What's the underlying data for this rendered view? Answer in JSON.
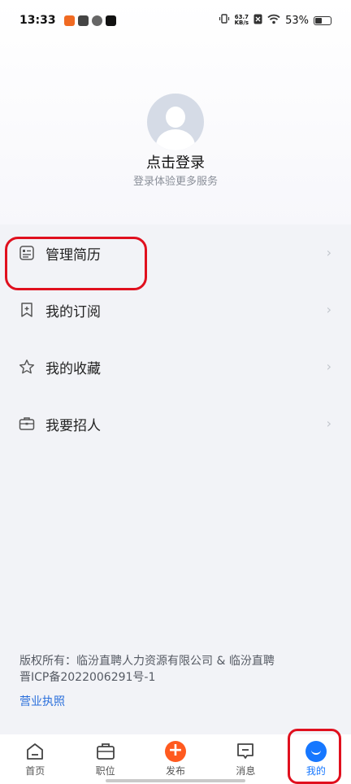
{
  "status_bar": {
    "time": "13:33",
    "net_speed_top": "63.7",
    "net_speed_unit": "KB/s",
    "battery": "53%"
  },
  "profile": {
    "login_title": "点击登录",
    "login_subtitle": "登录体验更多服务"
  },
  "menu": {
    "items": [
      {
        "label": "管理简历",
        "icon": "resume-icon"
      },
      {
        "label": "我的订阅",
        "icon": "bookmark-plus-icon"
      },
      {
        "label": "我的收藏",
        "icon": "star-icon"
      },
      {
        "label": "我要招人",
        "icon": "briefcase-icon"
      }
    ]
  },
  "footer": {
    "copyright": "版权所有：临汾直聘人力资源有限公司 & 临汾直聘",
    "icp": "晋ICP备2022006291号-1",
    "license_link": "营业执照"
  },
  "tabbar": {
    "items": [
      {
        "label": "首页",
        "icon": "home-icon"
      },
      {
        "label": "职位",
        "icon": "briefcase-icon"
      },
      {
        "label": "发布",
        "icon": "plus-circle-icon"
      },
      {
        "label": "消息",
        "icon": "message-icon"
      },
      {
        "label": "我的",
        "icon": "smile-icon"
      }
    ],
    "active": "我的"
  },
  "colors": {
    "accent": "#1677ff",
    "publish": "#ff5a1f",
    "highlight": "#e0101e"
  }
}
